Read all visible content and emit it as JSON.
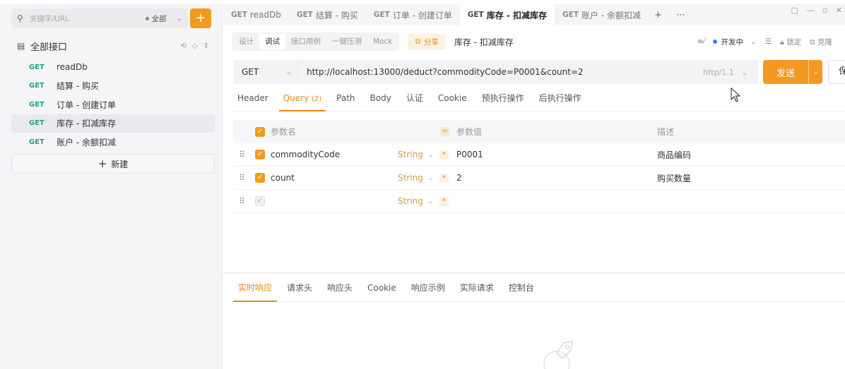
{
  "sidebar": {
    "search_placeholder": "关键字/URL",
    "filter_label": "全部",
    "add_label": "+",
    "root_label": "全部接口",
    "items": [
      {
        "method": "GET",
        "name": "readDb"
      },
      {
        "method": "GET",
        "name": "结算 - 购买"
      },
      {
        "method": "GET",
        "name": "订单 - 创建订单"
      },
      {
        "method": "GET",
        "name": "库存 - 扣减库存"
      },
      {
        "method": "GET",
        "name": "账户 - 余额扣减"
      }
    ],
    "active_index": 3,
    "new_label": "新建"
  },
  "tabs": [
    {
      "method": "GET",
      "name": "readDb"
    },
    {
      "method": "GET",
      "name": "结算 - 购买"
    },
    {
      "method": "GET",
      "name": "订单 - 创建订单"
    },
    {
      "method": "GET",
      "name": "库存 - 扣减库存"
    },
    {
      "method": "GET",
      "name": "账户 - 余额扣减"
    }
  ],
  "active_tab_index": 3,
  "subbar": {
    "modes": [
      "设计",
      "调试",
      "接口用例",
      "一键压测",
      "Mock"
    ],
    "active_mode": "调试",
    "share_label": "分享",
    "api_title": "库存 - 扣减库存",
    "env_label": "开发中",
    "lock_label": "锁定",
    "clone_label": "克隆"
  },
  "request": {
    "method": "GET",
    "url": "http://localhost:13000/deduct?commodityCode=P0001&count=2",
    "http_version": "http/1.1",
    "send_label": "发送",
    "save_label": "保"
  },
  "req_tabs": [
    {
      "label": "Header",
      "count": ""
    },
    {
      "label": "Query",
      "count": "(2)"
    },
    {
      "label": "Path",
      "count": ""
    },
    {
      "label": "Body",
      "count": ""
    },
    {
      "label": "认证",
      "count": ""
    },
    {
      "label": "Cookie",
      "count": ""
    },
    {
      "label": "预执行操作",
      "count": ""
    },
    {
      "label": "后执行操作",
      "count": ""
    }
  ],
  "active_req_tab": "Query",
  "params": {
    "headers": {
      "name": "参数名",
      "value": "参数值",
      "desc": "描述"
    },
    "rows": [
      {
        "name": "commodityCode",
        "type": "String",
        "value": "P0001",
        "desc": "商品编码",
        "checked": true
      },
      {
        "name": "count",
        "type": "String",
        "value": "2",
        "desc": "购买数量",
        "checked": true
      },
      {
        "name": "",
        "type": "String",
        "value": "",
        "desc": "",
        "checked": false
      }
    ]
  },
  "resp_tabs": [
    "实时响应",
    "请求头",
    "响应头",
    "Cookie",
    "响应示例",
    "实际请求",
    "控制台"
  ],
  "active_resp_tab": "实时响应",
  "colors": {
    "accent": "#f29a1f",
    "method_green": "#1fa37b",
    "status_blue": "#3b82f6"
  }
}
